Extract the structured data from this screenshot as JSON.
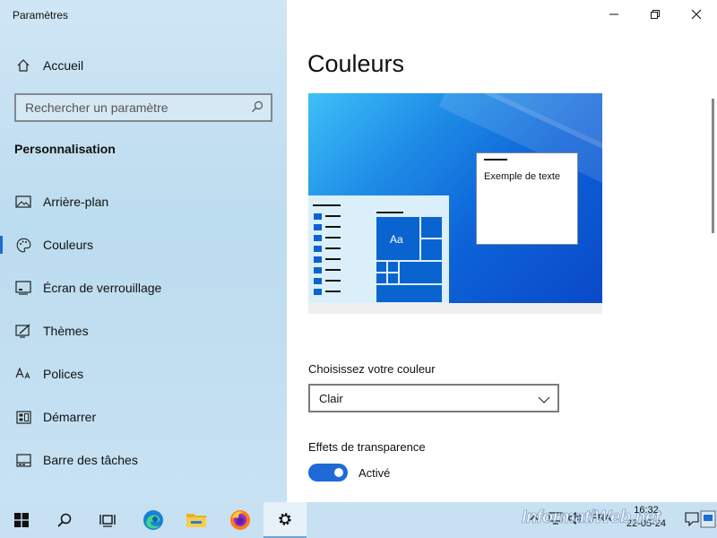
{
  "window": {
    "title": "Paramètres",
    "controls": {
      "minimize": "minimize-icon",
      "maximize": "restore-icon",
      "close": "close-icon"
    }
  },
  "sidebar": {
    "home_label": "Accueil",
    "search": {
      "placeholder": "Rechercher un paramètre"
    },
    "section_title": "Personnalisation",
    "items": [
      {
        "label": "Arrière-plan",
        "icon": "picture-icon",
        "active": false
      },
      {
        "label": "Couleurs",
        "icon": "palette-icon",
        "active": true
      },
      {
        "label": "Écran de verrouillage",
        "icon": "lock-screen-icon",
        "active": false
      },
      {
        "label": "Thèmes",
        "icon": "themes-icon",
        "active": false
      },
      {
        "label": "Polices",
        "icon": "fonts-icon",
        "active": false
      },
      {
        "label": "Démarrer",
        "icon": "start-icon",
        "active": false
      },
      {
        "label": "Barre des tâches",
        "icon": "taskbar-icon",
        "active": false
      }
    ]
  },
  "main": {
    "title": "Couleurs",
    "preview": {
      "sample_text": "Exemple de texte",
      "tile_text": "Aa"
    },
    "color_choice": {
      "label": "Choisissez votre couleur",
      "selected": "Clair"
    },
    "transparency": {
      "label": "Effets de transparence",
      "state": "Activé",
      "on": true
    }
  },
  "taskbar": {
    "apps": [
      "windows-start-icon",
      "search-icon",
      "task-view-icon",
      "edge-icon",
      "file-explorer-icon",
      "firefox-icon",
      "settings-gear-icon"
    ],
    "tray": {
      "language": "FRA"
    },
    "clock": {
      "time": "16:32",
      "date": "22-05-24"
    }
  },
  "watermark": "InformatiWeb.net",
  "colors": {
    "accent": "#1e6ad6",
    "sidebar_bg": "#c3dff1",
    "taskbar_bg": "#c7e1f2"
  }
}
